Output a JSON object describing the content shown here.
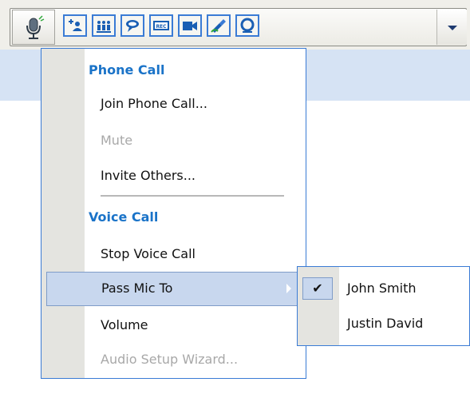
{
  "toolbar": {
    "buttons": [
      {
        "name": "microphone-icon"
      },
      {
        "name": "add-user-icon"
      },
      {
        "name": "attendees-icon"
      },
      {
        "name": "chat-icon"
      },
      {
        "name": "record-icon"
      },
      {
        "name": "video-icon"
      },
      {
        "name": "annotate-icon"
      },
      {
        "name": "share-icon"
      }
    ],
    "record_label": "REC",
    "dropdown": "chevron-down-icon"
  },
  "menu": {
    "phone_header": "Phone Call",
    "join_phone": "Join Phone Call...",
    "mute": "Mute",
    "invite": "Invite Others...",
    "voice_header": "Voice Call",
    "stop_voice": "Stop Voice Call",
    "pass_mic": "Pass Mic To",
    "volume": "Volume",
    "audio_wizard": "Audio Setup Wizard..."
  },
  "submenu": {
    "items": [
      {
        "label": "John Smith",
        "checked": true,
        "check_mark": "✔"
      },
      {
        "label": "Justin David",
        "checked": false
      }
    ]
  },
  "colors": {
    "accent": "#3a7bd5",
    "header_text": "#1a73c8",
    "highlight": "#c8d7ee",
    "disabled": "#a8a8a8",
    "band": "#d6e3f4"
  }
}
